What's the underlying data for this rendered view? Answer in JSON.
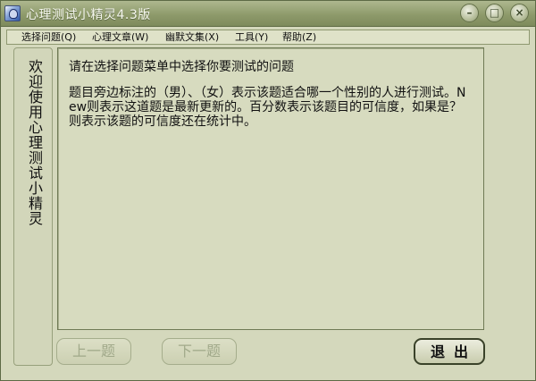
{
  "window": {
    "title": "心理测试小精灵4.3版",
    "controls": {
      "minimize": "–",
      "maximize": "□",
      "close": "×"
    }
  },
  "menu": {
    "items": [
      "选择问题(Q)",
      "心理文章(W)",
      "幽默文集(X)",
      "工具(Y)",
      "帮助(Z)"
    ]
  },
  "sidebar": {
    "welcome": "欢迎使用心理测试小精灵"
  },
  "content": {
    "instruction": "请在选择问题菜单中选择你要测试的问题",
    "description": "题目旁边标注的（男）、（女）表示该题适合哪一个性别的人进行测试。New则表示这道题是最新更新的。百分数表示该题目的可信度，如果是？则表示该题的可信度还在统计中。"
  },
  "buttons": {
    "prev": "上一题",
    "next": "下一题",
    "exit": "退出"
  },
  "colors": {
    "window_bg": "#d4d8bc",
    "titlebar": "#8e9a6b",
    "title_text": "#f5f6ee"
  }
}
